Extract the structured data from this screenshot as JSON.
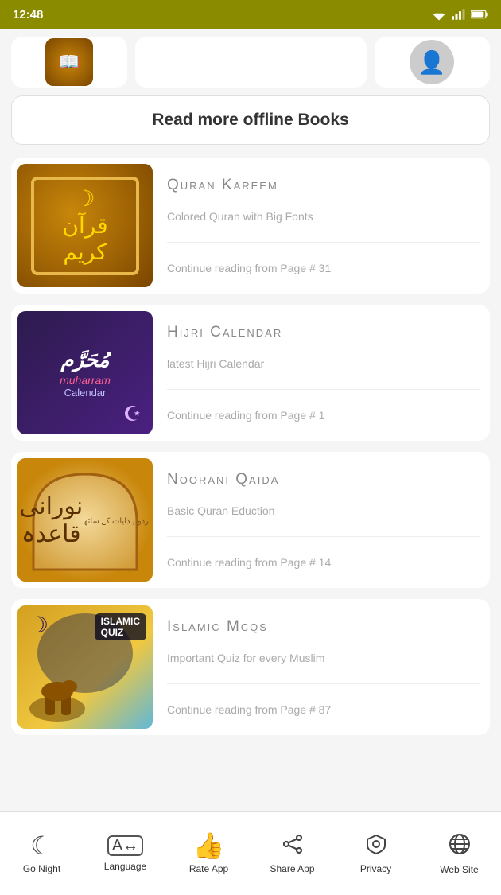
{
  "statusBar": {
    "time": "12:48"
  },
  "topSection": {
    "readMoreBtn": "Read more offline Books"
  },
  "books": [
    {
      "id": "quran-kareem",
      "title": "Quran  Kareem",
      "subtitle": "Colored Quran with Big Fonts",
      "pageInfo": "Continue reading from Page # 31",
      "iconType": "quran"
    },
    {
      "id": "hijri-calendar",
      "title": "Hijri  Calendar",
      "subtitle": "latest Hijri Calendar",
      "pageInfo": "Continue reading from Page # 1",
      "iconType": "hijri"
    },
    {
      "id": "noorani-qaida",
      "title": "Noorani  Qaida",
      "subtitle": "Basic Quran Eduction",
      "pageInfo": "Continue reading from Page # 14",
      "iconType": "noorani"
    },
    {
      "id": "islamic-mcqs",
      "title": "Islamic  Mcqs",
      "subtitle": "Important Quiz for every Muslim",
      "pageInfo": "Continue reading from Page # 87",
      "iconType": "islamic"
    }
  ],
  "bottomNav": [
    {
      "id": "go-night",
      "label": "Go Night",
      "icon": "☾"
    },
    {
      "id": "language",
      "label": "Language",
      "icon": "🔤"
    },
    {
      "id": "rate-app",
      "label": "Rate App",
      "icon": "👍"
    },
    {
      "id": "share-app",
      "label": "Share App",
      "icon": "⎇"
    },
    {
      "id": "privacy",
      "label": "Privacy",
      "icon": "🛡"
    },
    {
      "id": "web-site",
      "label": "Web Site",
      "icon": "🌐"
    }
  ]
}
